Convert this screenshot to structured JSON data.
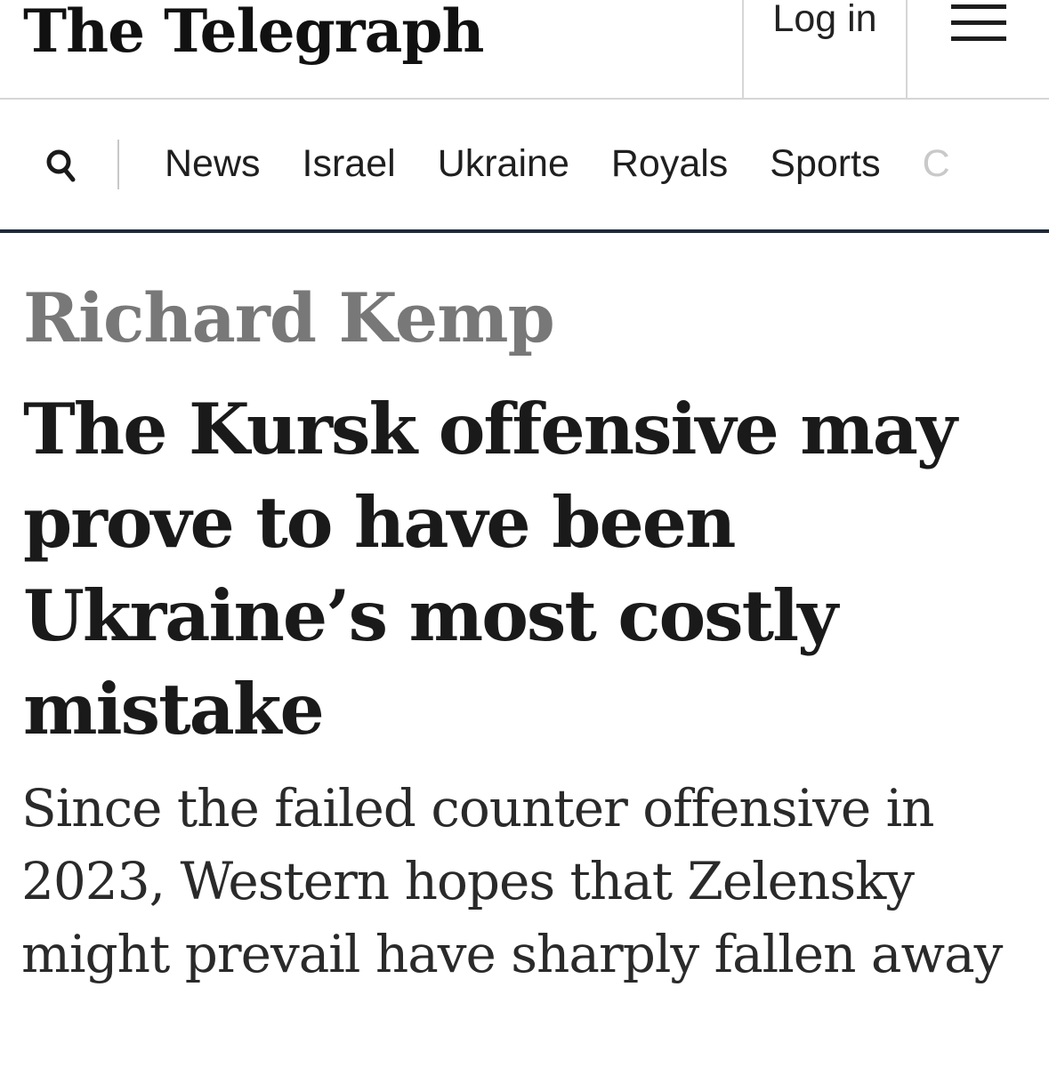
{
  "masthead": {
    "logo_text": "The Telegraph",
    "login_label": "Log in",
    "menu_icon": "hamburger-menu-icon"
  },
  "nav": {
    "search_icon": "search-icon",
    "items": [
      {
        "label": "News"
      },
      {
        "label": "Israel"
      },
      {
        "label": "Ukraine"
      },
      {
        "label": "Royals"
      },
      {
        "label": "Sports"
      },
      {
        "label": "C"
      }
    ]
  },
  "article": {
    "author": "Richard Kemp",
    "headline": "The Kursk offensive may prove to have been Ukraine’s most costly mistake",
    "standfirst": "Since the failed counter offensive in 2023, Western hopes that Zelensky might prevail have sharply fallen away"
  },
  "colors": {
    "nav_rule": "#1e2a3a",
    "author_grey": "#787878",
    "text_dark": "#1a1a1a"
  }
}
